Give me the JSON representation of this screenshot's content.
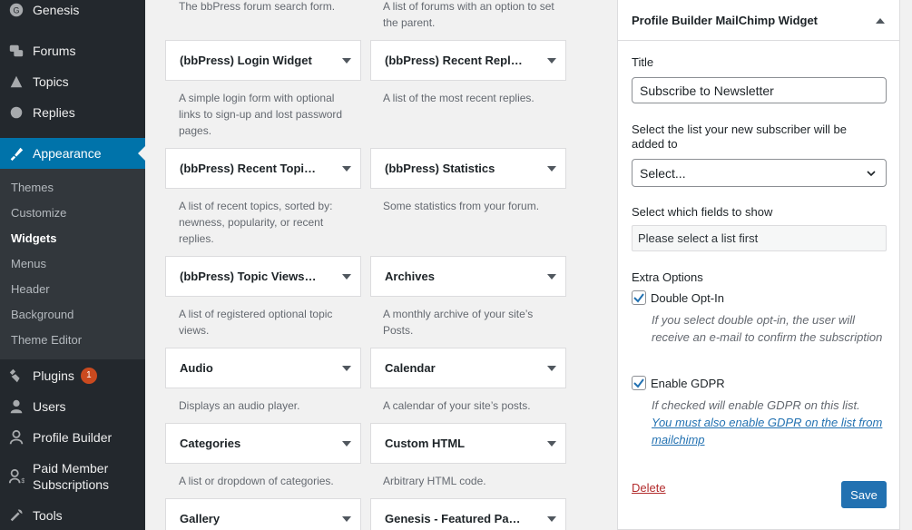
{
  "sidebar": {
    "site_name": "Genesis",
    "menu": [
      {
        "label": "Forums",
        "icon": "forums-icon"
      },
      {
        "label": "Topics",
        "icon": "topics-icon"
      },
      {
        "label": "Replies",
        "icon": "replies-icon"
      },
      {
        "label": "Appearance",
        "icon": "appearance-icon",
        "active": true
      },
      {
        "label": "Plugins",
        "icon": "plugins-icon",
        "badge": "1"
      },
      {
        "label": "Users",
        "icon": "users-icon"
      },
      {
        "label": "Profile Builder",
        "icon": "profile-builder-icon"
      },
      {
        "label": "Paid Member Subscriptions",
        "icon": "paid-member-icon"
      },
      {
        "label": "Tools",
        "icon": "tools-icon"
      }
    ],
    "submenu": [
      "Themes",
      "Customize",
      "Widgets",
      "Menus",
      "Header",
      "Background",
      "Theme Editor"
    ],
    "current_submenu": "Widgets"
  },
  "widgets": {
    "top_descriptions": [
      "The bbPress forum search form.",
      "A list of forums with an option to set the parent."
    ],
    "tiles": [
      {
        "title": "(bbPress) Login Widget",
        "desc": "A simple login form with optional links to sign-up and lost password pages."
      },
      {
        "title": "(bbPress) Recent Repl…",
        "desc": "A list of the most recent replies."
      },
      {
        "title": "(bbPress) Recent Topi…",
        "desc": "A list of recent topics, sorted by: newness, popularity, or recent replies."
      },
      {
        "title": "(bbPress) Statistics",
        "desc": "Some statistics from your forum."
      },
      {
        "title": "(bbPress) Topic Views…",
        "desc": "A list of registered optional topic views."
      },
      {
        "title": "Archives",
        "desc": "A monthly archive of your site’s Posts."
      },
      {
        "title": "Audio",
        "desc": "Displays an audio player."
      },
      {
        "title": "Calendar",
        "desc": "A calendar of your site’s posts."
      },
      {
        "title": "Categories",
        "desc": "A list or dropdown of categories."
      },
      {
        "title": "Custom HTML",
        "desc": "Arbitrary HTML code."
      },
      {
        "title": "Gallery",
        "desc": ""
      },
      {
        "title": "Genesis - Featured Pa…",
        "desc": ""
      }
    ]
  },
  "panel": {
    "header": "Profile Builder MailChimp Widget",
    "title_label": "Title",
    "title_value": "Subscribe to Newsletter",
    "list_label": "Select the list your new subscriber will be added to",
    "list_value": "Select...",
    "fields_label": "Select which fields to show",
    "fields_placeholder": "Please select a list first",
    "extra_label": "Extra Options",
    "double_optin_label": "Double Opt-In",
    "double_optin_checked": true,
    "double_optin_help": "If you select double opt-in, the user will receive an e-mail to confirm the subscription",
    "gdpr_label": "Enable GDPR",
    "gdpr_checked": true,
    "gdpr_help": "If checked will enable GDPR on this list.",
    "gdpr_link": "You must also enable GDPR on the list from mailchimp",
    "delete_label": "Delete",
    "save_label": "Save"
  }
}
